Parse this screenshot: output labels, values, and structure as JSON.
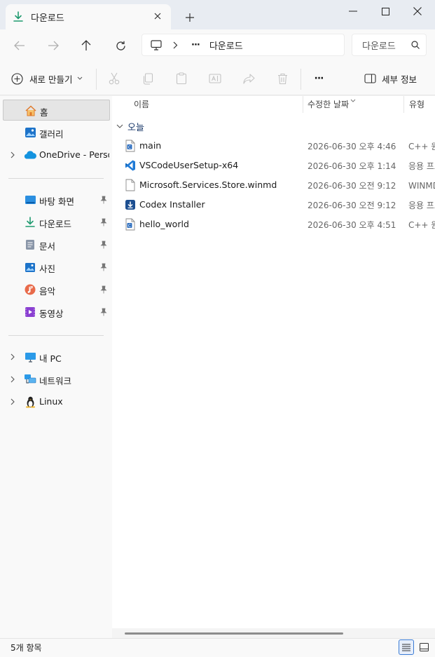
{
  "window": {
    "tab_title": "다운로드",
    "colors": {
      "accent": "#0067c0",
      "download_green": "#1f9a6f"
    }
  },
  "nav": {
    "breadcrumb_more": "···",
    "breadcrumb_current": "다운로드",
    "search_placeholder": "다운로드 검색"
  },
  "commandbar": {
    "new_label": "새로 만들기",
    "more": "···",
    "details_label": "세부 정보"
  },
  "sidebar": {
    "top": [
      {
        "label": "홈",
        "icon": "home-icon",
        "selected": true
      },
      {
        "label": "갤러리",
        "icon": "gallery-icon"
      },
      {
        "label": "OneDrive - Personal",
        "icon": "onedrive-icon",
        "expandable": true
      }
    ],
    "pinned": [
      {
        "label": "바탕 화면",
        "icon": "desktop-icon"
      },
      {
        "label": "다운로드",
        "icon": "download-icon"
      },
      {
        "label": "문서",
        "icon": "document-icon"
      },
      {
        "label": "사진",
        "icon": "pictures-icon"
      },
      {
        "label": "음악",
        "icon": "music-icon"
      },
      {
        "label": "동영상",
        "icon": "videos-icon"
      }
    ],
    "drives": [
      {
        "label": "내 PC",
        "icon": "pc-icon"
      },
      {
        "label": "네트워크",
        "icon": "network-icon"
      },
      {
        "label": "Linux",
        "icon": "linux-icon"
      }
    ]
  },
  "main": {
    "columns": {
      "name": "이름",
      "date": "수정한 날짜",
      "type": "유형"
    },
    "group_label": "오늘",
    "files": [
      {
        "name": "main",
        "date": "2026-06-30 오후 4:46",
        "type": "C++ 원본",
        "icon": "cpp-file-icon"
      },
      {
        "name": "VSCodeUserSetup-x64",
        "date": "2026-06-30 오후 1:14",
        "type": "응용 프로그램",
        "icon": "vscode-icon"
      },
      {
        "name": "Microsoft.Services.Store.winmd",
        "date": "2026-06-30 오전 9:12",
        "type": "WINMD 파일",
        "icon": "generic-file-icon"
      },
      {
        "name": "Codex Installer",
        "date": "2026-06-30 오전 9:12",
        "type": "응용 프로그램",
        "icon": "installer-icon"
      },
      {
        "name": "hello_world",
        "date": "2026-06-30 오후 4:51",
        "type": "C++ 원본",
        "icon": "cpp-file-icon"
      }
    ]
  },
  "status": {
    "item_count": "5개 항목"
  }
}
